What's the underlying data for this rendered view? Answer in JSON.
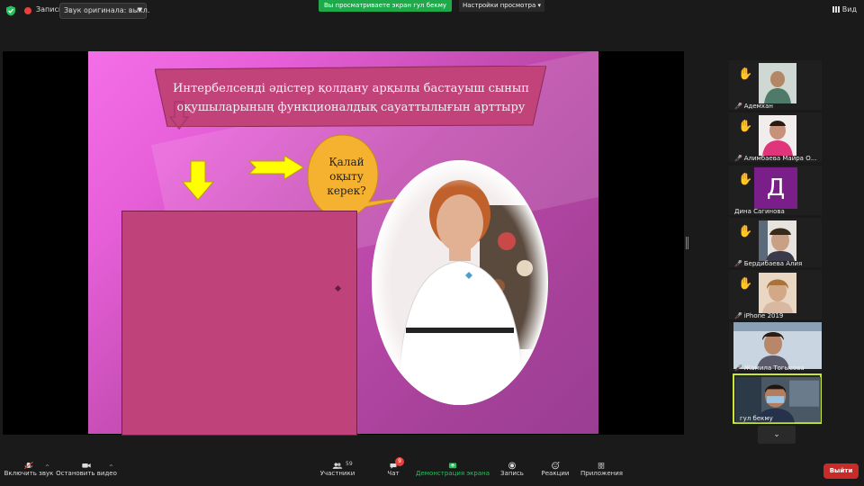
{
  "topbar": {
    "record_label": "Запись",
    "original_sound": "Звук оригинала: выкл.",
    "share_banner": "Вы просматриваете экран гул бекму",
    "view_settings": "Настройки просмотра",
    "view_label": "Вид"
  },
  "slide": {
    "title": "Интербелсенді әдістер қолдану арқылы бастауыш сынып оқушыларының функционалдық сауаттылығын арттыру",
    "bubble": "Қалай оқыту керек?"
  },
  "participants": [
    {
      "name": "Адемхан",
      "hand": true,
      "muted": true
    },
    {
      "name": "Алимбаева Майра О...",
      "hand": true,
      "muted": true
    },
    {
      "name": "Дина Сагинова",
      "hand": true,
      "muted": false,
      "avatar_letter": "Д"
    },
    {
      "name": "Бердибаева Алия",
      "hand": true,
      "muted": true
    },
    {
      "name": "iPhone 2019",
      "hand": true,
      "muted": true
    },
    {
      "name": "Жамила Тогысова",
      "hand": false,
      "muted": true
    },
    {
      "name": "гул бекму",
      "hand": false,
      "muted": false
    }
  ],
  "toolbar": {
    "unmute": "Включить звук",
    "stop_video": "Остановить видео",
    "participants": "Участники",
    "participants_count": "59",
    "chat": "Чат",
    "chat_badge": "9",
    "share_screen": "Демонстрация экрана",
    "record": "Запись",
    "reactions": "Реакции",
    "apps": "Приложения",
    "leave": "Выйти"
  },
  "colors": {
    "share_green": "#1ea94a",
    "leave_red": "#c82b28",
    "active_border": "#c8e63a",
    "hand_yellow": "#f3c037"
  }
}
